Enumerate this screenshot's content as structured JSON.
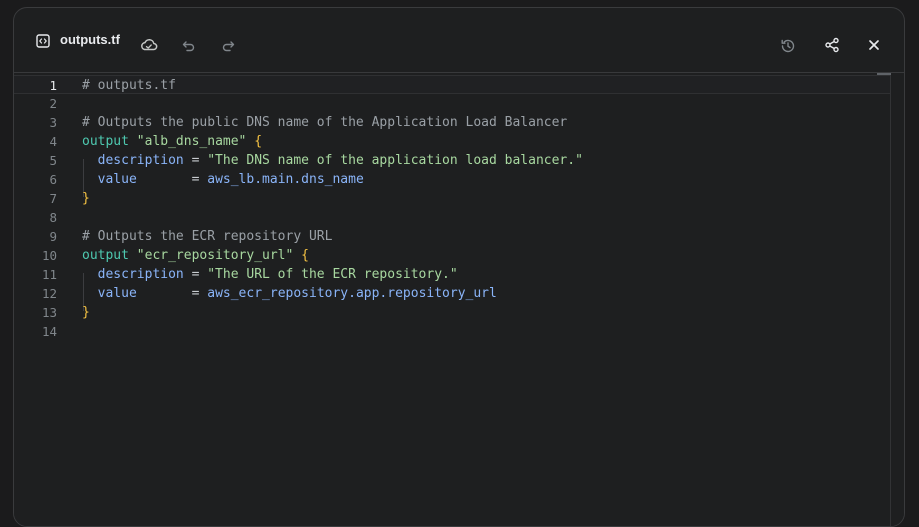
{
  "header": {
    "file_name": "outputs.tf",
    "icons": {
      "file": "code-file-icon",
      "save": "cloud-icon",
      "undo": "undo-icon",
      "redo": "redo-icon",
      "history": "history-icon",
      "share": "share-icon",
      "close": "close-icon"
    }
  },
  "editor": {
    "active_line": 1,
    "line_numbers": [
      "1",
      "2",
      "3",
      "4",
      "5",
      "6",
      "7",
      "8",
      "9",
      "10",
      "11",
      "12",
      "13",
      "14"
    ],
    "lines": [
      {
        "tokens": [
          {
            "t": "comment",
            "v": "# outputs.tf"
          }
        ]
      },
      {
        "tokens": []
      },
      {
        "tokens": [
          {
            "t": "comment",
            "v": "# Outputs the public DNS name of the Application Load Balancer"
          }
        ]
      },
      {
        "tokens": [
          {
            "t": "kw",
            "v": "output"
          },
          {
            "t": "op",
            "v": " "
          },
          {
            "t": "str",
            "v": "\"alb_dns_name\""
          },
          {
            "t": "op",
            "v": " "
          },
          {
            "t": "brace",
            "v": "{"
          }
        ]
      },
      {
        "tokens": [
          {
            "t": "op",
            "v": "  "
          },
          {
            "t": "attr",
            "v": "description"
          },
          {
            "t": "op",
            "v": " = "
          },
          {
            "t": "str",
            "v": "\"The DNS name of the application load balancer.\""
          }
        ]
      },
      {
        "tokens": [
          {
            "t": "op",
            "v": "  "
          },
          {
            "t": "attr",
            "v": "value"
          },
          {
            "t": "op",
            "v": "       = "
          },
          {
            "t": "ref",
            "v": "aws_lb.main.dns_name"
          }
        ]
      },
      {
        "tokens": [
          {
            "t": "brace",
            "v": "}"
          }
        ]
      },
      {
        "tokens": []
      },
      {
        "tokens": [
          {
            "t": "comment",
            "v": "# Outputs the ECR repository URL"
          }
        ]
      },
      {
        "tokens": [
          {
            "t": "kw",
            "v": "output"
          },
          {
            "t": "op",
            "v": " "
          },
          {
            "t": "str",
            "v": "\"ecr_repository_url\""
          },
          {
            "t": "op",
            "v": " "
          },
          {
            "t": "brace",
            "v": "{"
          }
        ]
      },
      {
        "tokens": [
          {
            "t": "op",
            "v": "  "
          },
          {
            "t": "attr",
            "v": "description"
          },
          {
            "t": "op",
            "v": " = "
          },
          {
            "t": "str",
            "v": "\"The URL of the ECR repository.\""
          }
        ]
      },
      {
        "tokens": [
          {
            "t": "op",
            "v": "  "
          },
          {
            "t": "attr",
            "v": "value"
          },
          {
            "t": "op",
            "v": "       = "
          },
          {
            "t": "ref",
            "v": "aws_ecr_repository.app.repository_url"
          }
        ]
      },
      {
        "tokens": [
          {
            "t": "brace",
            "v": "}"
          }
        ]
      },
      {
        "tokens": []
      }
    ]
  },
  "colors": {
    "background": "#1e1f20",
    "comment": "#9aa0a6",
    "keyword": "#4ec9b0",
    "string": "#a8d8a0",
    "brace": "#f6c343",
    "attribute": "#8ab4f8"
  }
}
